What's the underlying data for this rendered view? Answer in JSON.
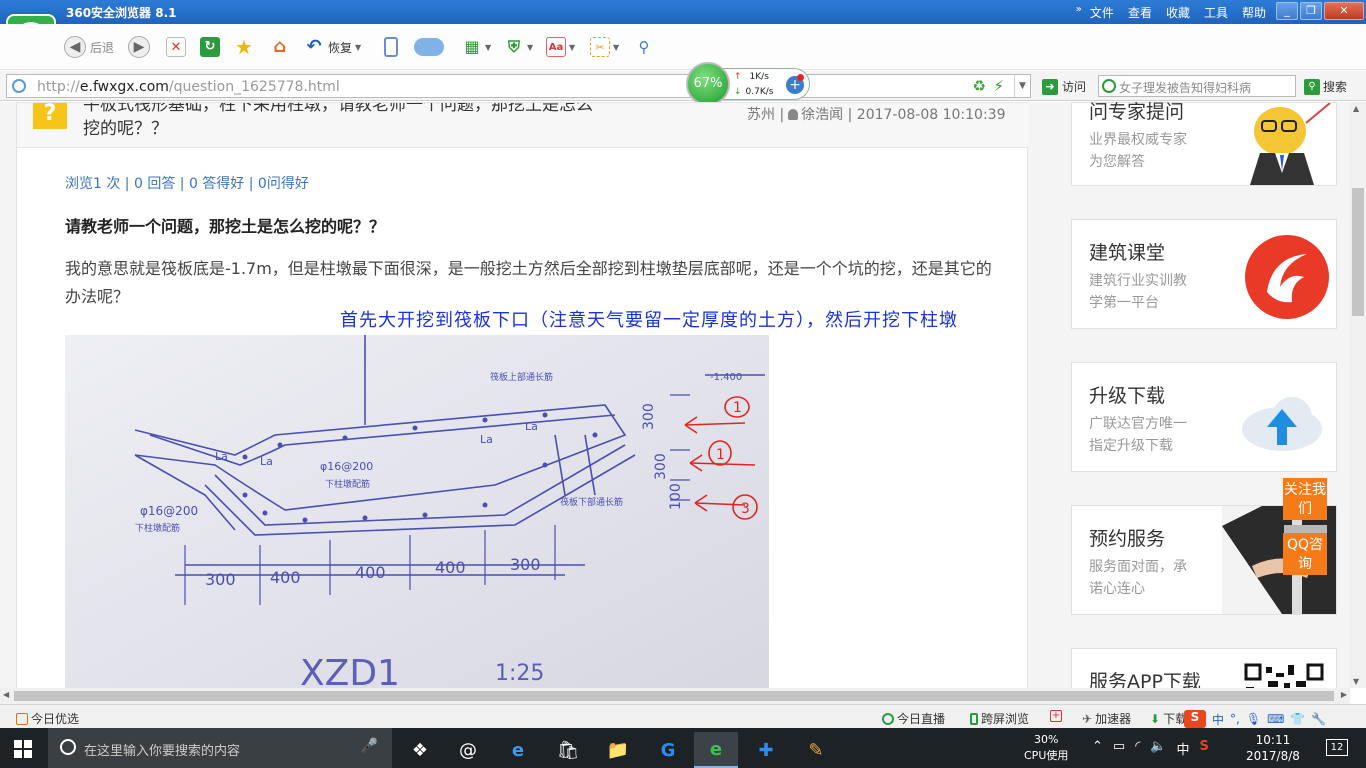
{
  "browser": {
    "title": "360安全浏览器 8.1",
    "menus": [
      "文件",
      "查看",
      "收藏",
      "工具",
      "帮助"
    ],
    "back_label": "后退",
    "restore_label": "恢复",
    "url_host": "e.fwxgx.com",
    "url_prefix": "http://",
    "url_path": "/question_1625778.html",
    "go_label": "访问",
    "search_placeholder": "女子理发被告知得妇科病",
    "search_button": "搜索"
  },
  "net": {
    "percent": "67%",
    "up": "1K/s",
    "down": "0.7K/s"
  },
  "question": {
    "title_line1": "平板式筏形基础，柱下采用柱墩，请教老师一个问题，那挖土是怎么",
    "title_line2": "挖的呢？？",
    "location": "苏州",
    "user": "徐浩闻",
    "datetime": "2017-08-08 10:10:39",
    "stats": "浏览1 次 | 0 回答 | 0 答得好 | 0问得好",
    "subtitle": "请教老师一个问题，那挖土是怎么挖的呢？？",
    "body": "我的意思就是筏板底是-1.7m，但是柱墩最下面很深，是一般挖土方然后全部挖到柱墩垫层底部呢，还是一个个坑的挖，还是其它的办法呢？",
    "answer": "首先大开挖到筏板下口（注意天气要留一定厚度的土方），然后开挖下柱墩"
  },
  "drawing": {
    "title": "XZD1",
    "scale": "1:25",
    "elev": "-1.400",
    "top_bar": "筏板上部通长筋",
    "bottom_bar": "筏板下部通长筋",
    "rebar1": "φ16@200",
    "rebar1_sub": "下柱墩配筋",
    "rebar2": "φ16@200",
    "rebar2_sub": "下柱墩配筋",
    "la": "La",
    "dims": [
      "300",
      "400",
      "400",
      "400",
      "300"
    ],
    "vdims": [
      "300",
      "300",
      "100"
    ],
    "marks": [
      "1",
      "1",
      "3"
    ]
  },
  "sidebar": [
    {
      "title": "问专家提问",
      "desc1": "业界最权威专家",
      "desc2": "为您解答"
    },
    {
      "title": "建筑课堂",
      "desc1": "建筑行业实训教",
      "desc2": "学第一平台"
    },
    {
      "title": "升级下载",
      "desc1": "广联达官方唯一",
      "desc2": "指定升级下载"
    },
    {
      "title": "预约服务",
      "desc1": "服务面对面，承",
      "desc2": "诺心连心"
    },
    {
      "title": "服务APP下载",
      "desc1": "",
      "desc2": ""
    }
  ],
  "float": {
    "follow": "关注我们",
    "qq": "QQ咨询"
  },
  "statusbar": {
    "left": "今日优选",
    "live": "今日直播",
    "crossscreen": "跨屏浏览",
    "accelerator": "加速器",
    "download": "下载"
  },
  "taskbar": {
    "search_placeholder": "在这里输入你要搜索的内容",
    "cpu_percent": "30%",
    "cpu_label": "CPU使用",
    "ime": "中",
    "time": "10:11",
    "date": "2017/8/8",
    "notifications": "12"
  },
  "colors": {
    "accent": "#1f64bd",
    "answer": "#1a32d6",
    "link": "#3b75c2",
    "orange": "#f57b18",
    "question_icon": "#f5c518"
  }
}
